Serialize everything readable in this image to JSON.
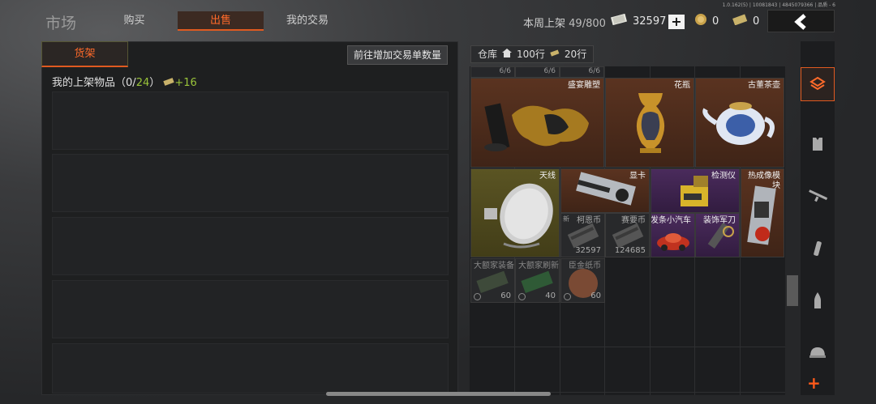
{
  "version": "1.0.162(5) | 10081843 | 4845079366 | 品质 - 6",
  "title": "市场",
  "tabs": [
    {
      "label": "购买",
      "active": false
    },
    {
      "label": "出售",
      "active": true
    },
    {
      "label": "我的交易",
      "active": false
    }
  ],
  "weekly": {
    "label": "本周上架",
    "value": "49/800"
  },
  "currency": {
    "cash": "32597",
    "coin": "0",
    "ticket": "0"
  },
  "shelf": {
    "tab_label": "货架",
    "goto_button": "前往增加交易单数量",
    "listed_prefix": "我的上架物品（",
    "listed_count": "0",
    "listed_sep": "/",
    "listed_max": "24",
    "listed_suffix": "）",
    "listed_bonus": "+16"
  },
  "warehouse": {
    "label": "仓库",
    "rows1": "100行",
    "rows2": "20行",
    "top_strip": [
      "6/6",
      "6/6",
      "6/6"
    ],
    "items": [
      {
        "name": "盛宴雕塑",
        "rarity": "brown"
      },
      {
        "name": "花瓶",
        "rarity": "brown"
      },
      {
        "name": "古董茶壶",
        "rarity": "brown"
      },
      {
        "name": "天线",
        "rarity": "olive"
      },
      {
        "name": "显卡",
        "rarity": "brown"
      },
      {
        "name": "检测仪",
        "rarity": "purple"
      },
      {
        "name": "热成像模块",
        "rarity": "brown"
      },
      {
        "name": "柯恩币",
        "count": "32597",
        "badge": "新",
        "rarity": "dark"
      },
      {
        "name": "赛要币",
        "count": "124685",
        "rarity": "dark"
      },
      {
        "name": "发条小汽车",
        "rarity": "purple"
      },
      {
        "name": "装饰军刀",
        "rarity": "purple"
      },
      {
        "name": "大额家装备",
        "count": "60",
        "rarity": "dark"
      },
      {
        "name": "大额家刷新",
        "count": "40",
        "rarity": "dark"
      },
      {
        "name": "臣金纸币",
        "count": "60",
        "rarity": "dark"
      }
    ]
  },
  "sidebar": [
    "warehouse-icon",
    "armor-vest-icon",
    "rifle-icon",
    "magazine-icon",
    "bullet-icon",
    "helmet-icon"
  ],
  "colors": {
    "accent": "#e05a20",
    "green": "#9ac43a"
  }
}
